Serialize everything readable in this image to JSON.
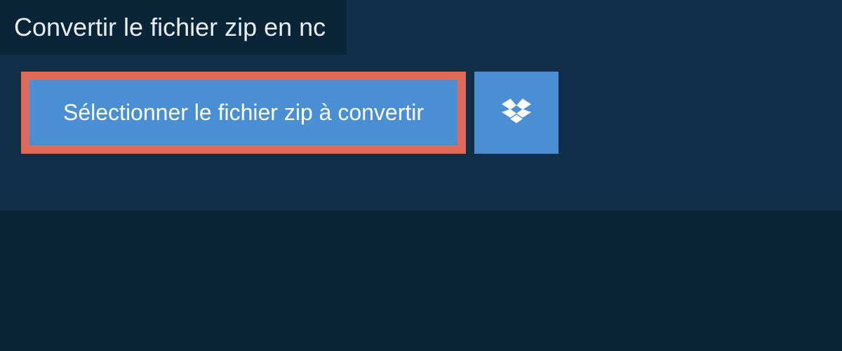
{
  "tab": {
    "title": "Convertir le fichier zip en nc"
  },
  "buttons": {
    "select_file_label": "Sélectionner le fichier zip à convertir"
  }
}
